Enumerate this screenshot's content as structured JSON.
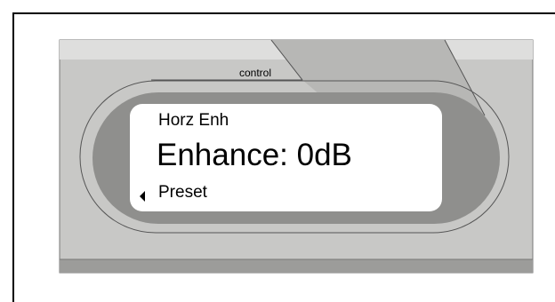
{
  "tab": {
    "label": "control"
  },
  "display": {
    "line1": "Horz Enh",
    "line2": "Enhance: 0dB",
    "line3": "Preset",
    "arrow_icon": "left-triangle-icon"
  },
  "colors": {
    "panel": "#c8c8c6",
    "panel_dark": "#a9a9a7",
    "bezel": "#8f8f8d",
    "bottom_bar": "#9c9c9a",
    "screen": "#ffffff"
  }
}
